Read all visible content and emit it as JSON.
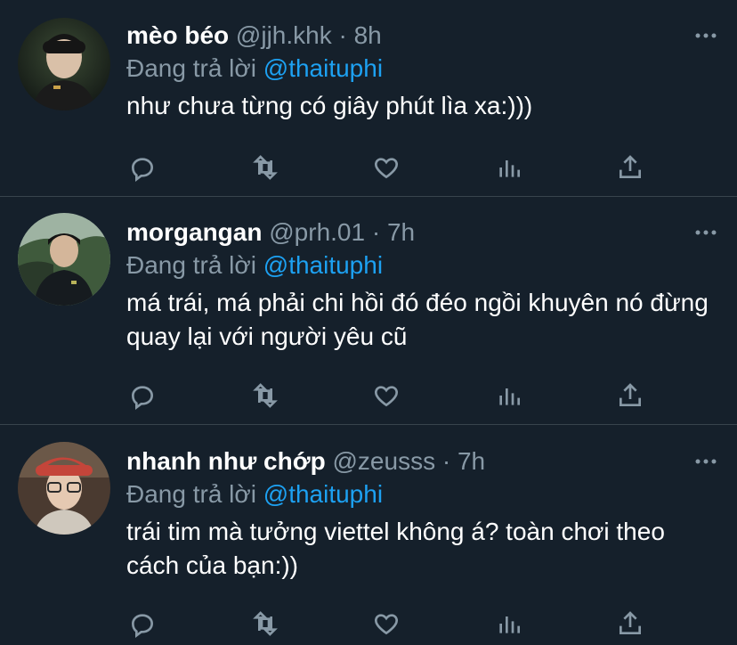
{
  "tweets": [
    {
      "name": "mèo béo",
      "handle": "@jjh.khk",
      "dot": "·",
      "time": "8h",
      "replying_prefix": "Đang trả lời ",
      "replying_to": "@thaituphi",
      "text": "như chưa từng có giây phút lìa xa:)))",
      "avatar_colors": [
        "#2f3a2a",
        "#1f2421",
        "#0f1412"
      ]
    },
    {
      "name": "morgangan",
      "handle": "@prh.01",
      "dot": "·",
      "time": "7h",
      "replying_prefix": "Đang trả lời ",
      "replying_to": "@thaituphi",
      "text": "má trái, má phải chi hồi đó đéo ngồi khuyên nó đừng quay lại với người yêu cũ",
      "avatar_colors": [
        "#a8b89a",
        "#2a3a2d",
        "#141a14"
      ]
    },
    {
      "name": "nhanh như chớp",
      "handle": "@zeusss",
      "dot": "·",
      "time": "7h",
      "replying_prefix": "Đang trả lời ",
      "replying_to": "@thaituphi",
      "text": "trái tim mà tưởng viettel không á? toàn chơi theo cách của bạn:))",
      "avatar_colors": [
        "#b5603a",
        "#d9b59e",
        "#3a2a23"
      ]
    }
  ],
  "colors": {
    "background": "#15202b",
    "secondary_text": "#8899a6",
    "accent": "#1da1f2",
    "divider": "#38444d"
  },
  "icons": [
    "reply-icon",
    "retweet-icon",
    "like-icon",
    "analytics-icon",
    "share-icon",
    "more-icon"
  ]
}
